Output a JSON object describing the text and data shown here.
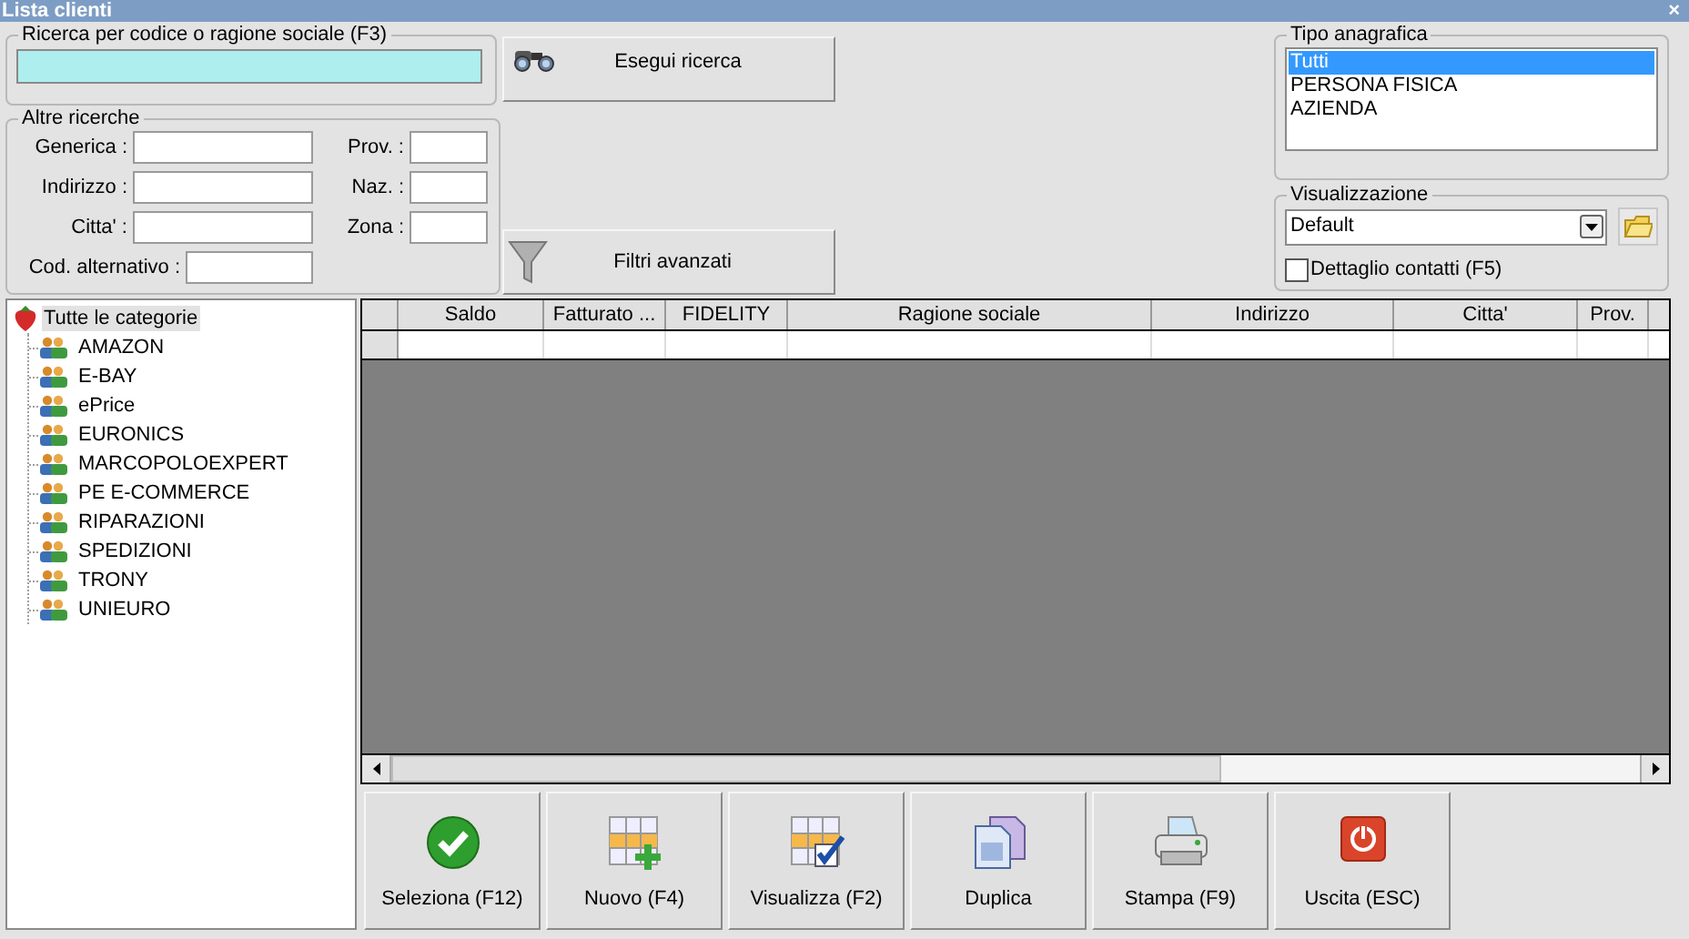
{
  "window": {
    "title": "Lista clienti",
    "close": "×"
  },
  "search": {
    "legend": "Ricerca per codice o ragione sociale (F3)",
    "button": "Esegui ricerca"
  },
  "other_searches": {
    "legend": "Altre ricerche",
    "fields": [
      {
        "label": "Generica :",
        "kind": "wide"
      },
      {
        "label": "Prov. :",
        "kind": "narrow"
      },
      {
        "label": "Indirizzo :",
        "kind": "wide"
      },
      {
        "label": "Naz. :",
        "kind": "narrow"
      },
      {
        "label": "Citta' :",
        "kind": "wide"
      },
      {
        "label": "Zona :",
        "kind": "narrow"
      },
      {
        "label": "Cod. alternativo :",
        "kind": "alt"
      }
    ]
  },
  "filters_button": "Filtri avanzati",
  "tipo_anagrafica": {
    "legend": "Tipo anagrafica",
    "options": [
      {
        "label": "Tutti",
        "selected": true
      },
      {
        "label": "PERSONA FISICA",
        "selected": false
      },
      {
        "label": "AZIENDA",
        "selected": false
      }
    ]
  },
  "visualizzazione": {
    "legend": "Visualizzazione",
    "value": "Default",
    "detail_checkbox": {
      "label": "Dettaglio contatti (F5)",
      "checked": false
    }
  },
  "tree": {
    "label": "Tutte le categorie",
    "selected": true,
    "children": [
      {
        "label": "AMAZON",
        "selected": false
      },
      {
        "label": "E-BAY",
        "selected": false
      },
      {
        "label": "ePrice",
        "selected": false
      },
      {
        "label": "EURONICS",
        "selected": false
      },
      {
        "label": "MARCOPOLOEXPERT",
        "selected": false
      },
      {
        "label": "PE E-COMMERCE",
        "selected": false
      },
      {
        "label": "RIPARAZIONI",
        "selected": false
      },
      {
        "label": "SPEDIZIONI",
        "selected": false
      },
      {
        "label": "TRONY",
        "selected": false
      },
      {
        "label": "UNIEURO",
        "selected": false
      }
    ]
  },
  "table": {
    "columns": [
      "Saldo",
      "Fatturato ...",
      "FIDELITY",
      "Ragione sociale",
      "Indirizzo",
      "Citta'",
      "Prov."
    ]
  },
  "actions": [
    {
      "label": "Seleziona (F12)",
      "kind": "select"
    },
    {
      "label": "Nuovo (F4)",
      "kind": "new"
    },
    {
      "label": "Visualizza (F2)",
      "kind": "view"
    },
    {
      "label": "Duplica",
      "kind": "duplicate"
    },
    {
      "label": "Stampa (F9)",
      "kind": "print"
    },
    {
      "label": "Uscita (ESC)",
      "kind": "exit"
    }
  ]
}
